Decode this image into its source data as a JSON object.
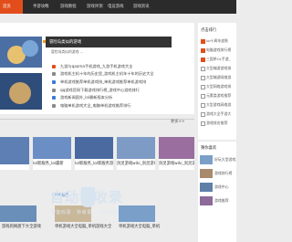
{
  "nav": {
    "items": [
      {
        "label": "首页"
      },
      {
        "label": "手游攻略"
      },
      {
        "label": "游戏教程"
      },
      {
        "label": "游戏评测"
      },
      {
        "label": "电竞游戏"
      },
      {
        "label": "游戏资讯"
      }
    ]
  },
  "featured": {
    "title": "冒险岛类似的游戏",
    "subtitle": "冒险岛类似的游戏 ..."
  },
  "news": [
    {
      "title": "九游与qaama手机游戏_九游手机游戏大全"
    },
    {
      "title": "游戏机主机十年的历史里_游戏机主机年十年的历史大全"
    },
    {
      "title": "单机游戏推荐单机游戏排_单机游戏推荐单机游戏排"
    },
    {
      "title": "qq游戏官网下载游戏排行榜_游戏中心游戏排行"
    },
    {
      "title": "游戏新闻国外_lol最新版本分析"
    },
    {
      "title": "电脑单机游戏大全_电脑单机游戏推荐排行"
    }
  ],
  "section": {
    "more": "更多>>"
  },
  "cards": [
    {
      "caption": ""
    },
    {
      "caption": "lol新服务_lol最新"
    },
    {
      "caption": "lol新服务_lol新服务游戏"
    },
    {
      "caption": "剑灵游戏wiki_剑灵游戏wiki攻略"
    },
    {
      "caption": "剑灵游戏wiki_剑灵游戏w"
    }
  ],
  "tag": "+文章标签",
  "bottom": [
    {
      "caption": "游戏的网盘下大全游戏"
    },
    {
      "caption": "单机游戏大全电脑_单机游戏大全"
    },
    {
      "caption": "单机游戏大全电脑_单机"
    }
  ],
  "sidebar": {
    "hot_title": "点击排行",
    "hot": [
      {
        "title": "lol十周年皮肤"
      },
      {
        "title": "电脑游戏排行榜"
      },
      {
        "title": "三国杀OL手游_"
      },
      {
        "title": "大型端游游戏排"
      },
      {
        "title": "大型端游网络游"
      },
      {
        "title": "大型网络游戏排"
      },
      {
        "title": "元素类游戏推荐"
      },
      {
        "title": "大型游戏网络游"
      },
      {
        "title": "游戏大全手游大"
      },
      {
        "title": "游戏排名推荐"
      }
    ],
    "rec_title": "猜你喜欢",
    "rec": [
      {
        "title": "好玩大型游戏"
      },
      {
        "title": "游戏排行榜"
      },
      {
        "title": "游戏中心"
      },
      {
        "title": "游戏推荐"
      }
    ]
  },
  "watermark": {
    "title": "自动秒收录",
    "subtitle": "智能收录 · 秒收录 · 一键收录"
  }
}
